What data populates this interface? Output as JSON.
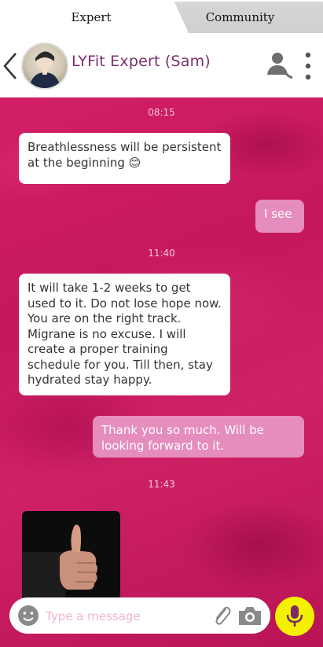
{
  "tabs": {
    "expert": "Expert",
    "community": "Community"
  },
  "header": {
    "title": "LYFit Expert (Sam)"
  },
  "messages": {
    "t1": "08:15",
    "m1": "Breathlessness will be persistent at the beginning 😊",
    "m2": "I see",
    "t2": "11:40",
    "m3": "It will take 1-2 weeks to get used to it. Do not lose hope now. You are on the right track. Migrane is no excuse. I will create a proper training schedule for you. Till then, stay hydrated stay happy.",
    "m4": "Thank you so much. Will be looking forward to it.",
    "t3": "11:43"
  },
  "input": {
    "placeholder": "Type a message"
  },
  "colors": {
    "accent": "#7d2d6f",
    "outgoing_bubble": "#e58dbd",
    "mic": "#f3f000"
  }
}
